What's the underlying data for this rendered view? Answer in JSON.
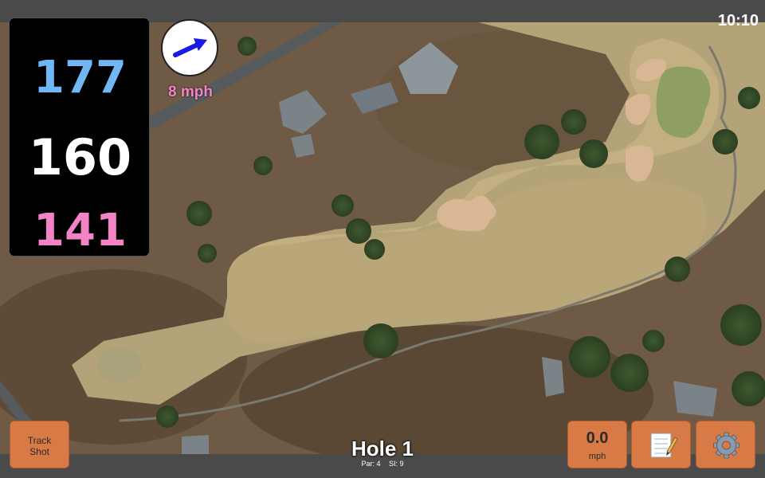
{
  "status": {
    "time": "10:10"
  },
  "distances": {
    "back": "177",
    "middle": "160",
    "front": "141"
  },
  "wind": {
    "speed_text": "8 mph",
    "icon": "wind-direction-arrow-icon"
  },
  "buttons": {
    "track_shot_line1": "Track",
    "track_shot_line2": "Shot",
    "wind_value": "0.0",
    "wind_unit": "mph",
    "notes_icon": "notepad-icon",
    "settings_icon": "gear-icon"
  },
  "hole": {
    "title": "Hole 1",
    "par": "Par: 4",
    "si": "SI: 9"
  },
  "colors": {
    "back": "#6fb8f5",
    "middle": "#ffffff",
    "front": "#f283c4",
    "button": "#d87a45"
  }
}
